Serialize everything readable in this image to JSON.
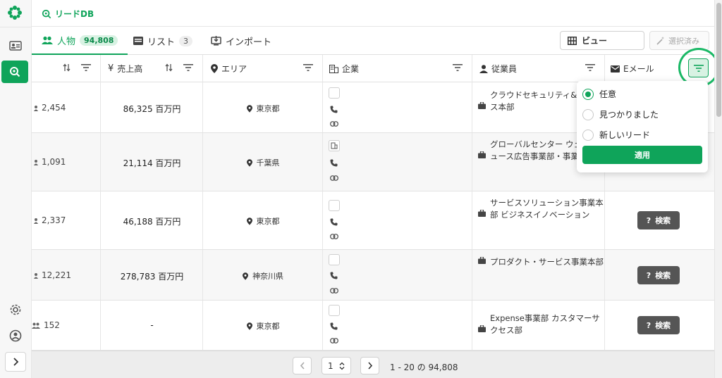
{
  "app": {
    "title": "リードDB",
    "accent": "#0fa45a"
  },
  "tabs": [
    {
      "label": "人物",
      "count": "94,808",
      "icon": "people-icon"
    },
    {
      "label": "リスト",
      "count": "3",
      "icon": "list-icon"
    },
    {
      "label": "インポート",
      "count": "",
      "icon": "import-icon"
    }
  ],
  "toolbar": {
    "view_label": "ビュー",
    "selected_label": "選択済み"
  },
  "columns": {
    "revenue": "売上高",
    "area": "エリア",
    "company": "企業",
    "employee": "従業員",
    "email": "Eメール"
  },
  "rows": [
    {
      "employees": "2,454",
      "revenue": "86,325 百万円",
      "area": "東京都",
      "dept": "クラウドセキュリティ&サービス本部",
      "has_search": false
    },
    {
      "employees": "1,091",
      "revenue": "21,114 百万円",
      "area": "千葉県",
      "dept": "グローバルセンター ウェブニュース広告事業部・事業",
      "has_search": false
    },
    {
      "employees": "2,337",
      "revenue": "46,188 百万円",
      "area": "東京都",
      "dept": "サービスソリューション事業本部 ビジネスイノベーション",
      "has_search": true
    },
    {
      "employees": "12,221",
      "revenue": "278,783 百万円",
      "area": "神奈川県",
      "dept": "プロダクト・サービス事業本部",
      "has_search": true
    },
    {
      "employees": "152",
      "revenue": "-",
      "area": "東京都",
      "dept": "Expense事業部 カスタマーサクセス部",
      "has_search": true
    }
  ],
  "search_label": "検索",
  "filter_popup": {
    "options": [
      "任意",
      "見つかりました",
      "新しいリード"
    ],
    "selected": "任意",
    "apply_label": "適用"
  },
  "pagination": {
    "page": "1",
    "info": "1 - 20 の 94,808"
  }
}
